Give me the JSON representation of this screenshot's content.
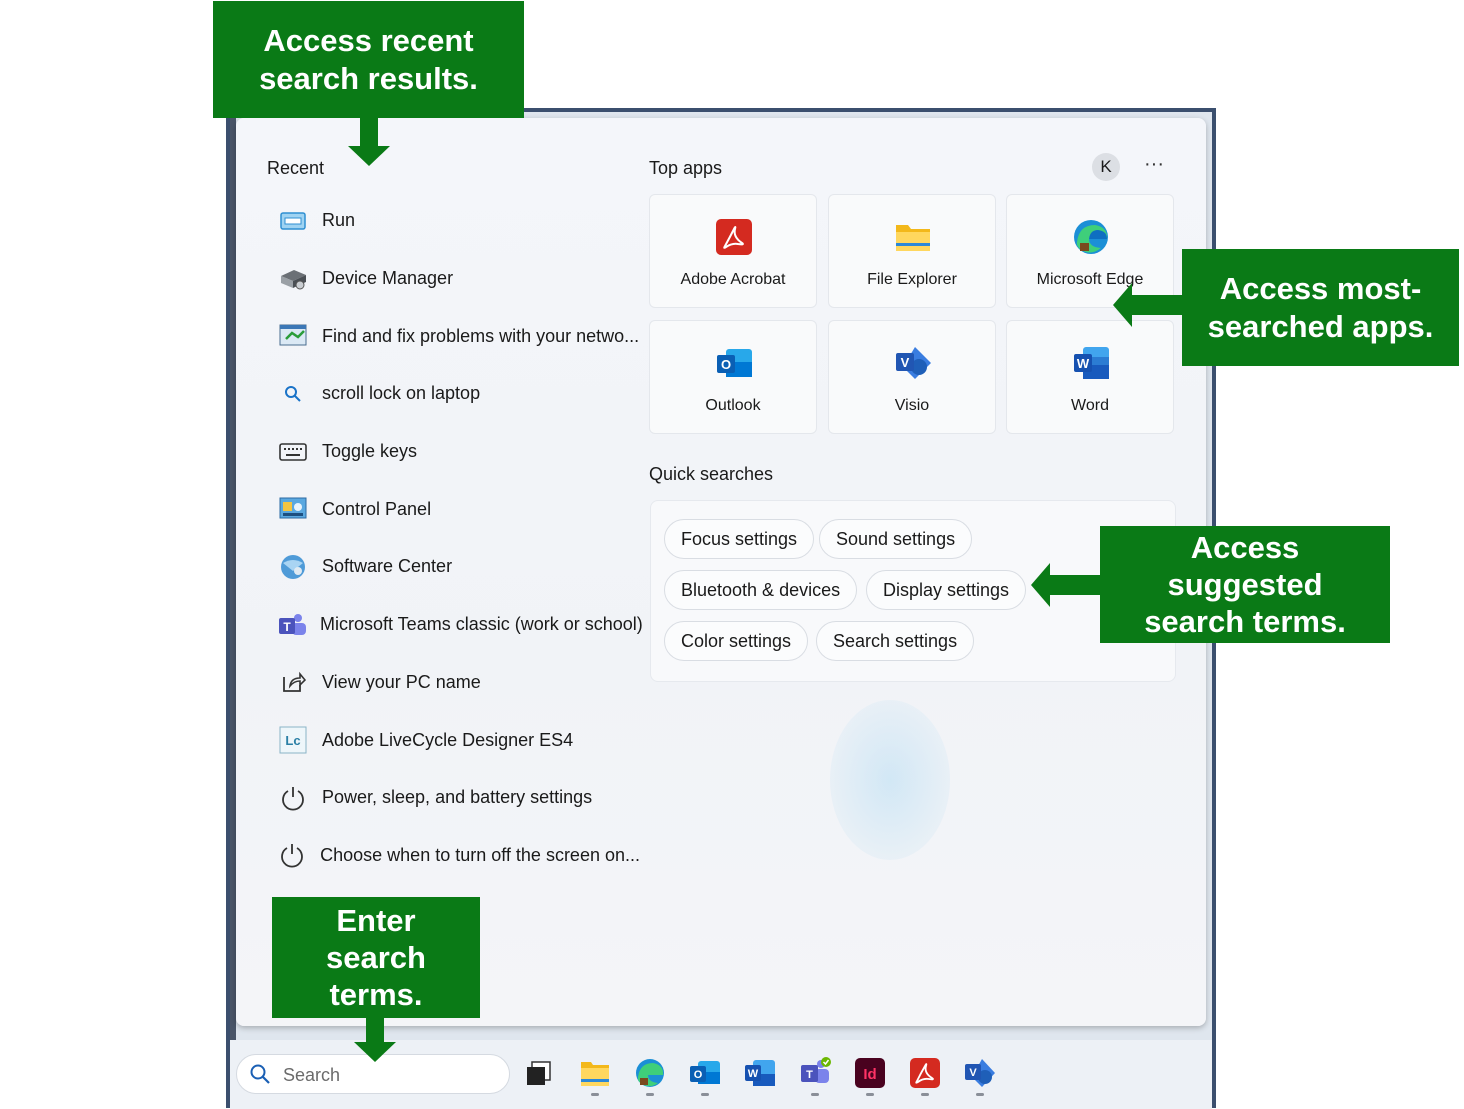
{
  "recent": {
    "heading": "Recent",
    "items": [
      {
        "label": "Run",
        "icon": "run-icon"
      },
      {
        "label": "Device Manager",
        "icon": "device-manager-icon"
      },
      {
        "label": "Find and fix problems with your netwo...",
        "icon": "network-troubleshoot-icon"
      },
      {
        "label": "scroll lock on laptop",
        "icon": "search-icon"
      },
      {
        "label": "Toggle keys",
        "icon": "keyboard-icon"
      },
      {
        "label": "Control Panel",
        "icon": "control-panel-icon"
      },
      {
        "label": "Software Center",
        "icon": "software-center-icon"
      },
      {
        "label": "Microsoft Teams classic (work or school)",
        "icon": "teams-icon"
      },
      {
        "label": "View your PC name",
        "icon": "share-icon"
      },
      {
        "label": "Adobe LiveCycle Designer ES4",
        "icon": "livecycle-icon"
      },
      {
        "label": "Power, sleep, and battery settings",
        "icon": "power-icon"
      },
      {
        "label": "Choose when to turn off the screen on...",
        "icon": "power-icon"
      }
    ]
  },
  "top_apps": {
    "heading": "Top apps",
    "avatar_letter": "K",
    "more_label": "···",
    "apps": [
      {
        "label": "Adobe Acrobat",
        "icon": "acrobat-icon"
      },
      {
        "label": "File Explorer",
        "icon": "folder-icon"
      },
      {
        "label": "Microsoft Edge",
        "icon": "edge-icon"
      },
      {
        "label": "Outlook",
        "icon": "outlook-icon"
      },
      {
        "label": "Visio",
        "icon": "visio-icon"
      },
      {
        "label": "Word",
        "icon": "word-icon"
      }
    ]
  },
  "quick_searches": {
    "heading": "Quick searches",
    "pills": [
      "Focus settings",
      "Sound settings",
      "Bluetooth & devices",
      "Display settings",
      "Color settings",
      "Search settings"
    ]
  },
  "taskbar": {
    "search_placeholder": "Search",
    "icons": [
      "task-view-icon",
      "file-explorer-icon",
      "edge-icon",
      "outlook-icon",
      "word-icon",
      "teams-icon",
      "indesign-icon",
      "acrobat-icon",
      "visio-icon"
    ],
    "indesign_label": "Id",
    "word_letter": "W",
    "outlook_letter": "O",
    "visio_letter": "V",
    "teams_letter": "T",
    "lc_label": "Lc"
  },
  "callouts": {
    "recent": "Access recent\nsearch results.",
    "top_apps": "Access most-\nsearched apps.",
    "quick": "Access\nsuggested\nsearch terms.",
    "search": "Enter\nsearch\nterms."
  },
  "colors": {
    "callout_green": "#0a7a16",
    "frame": "#3b4f6e"
  }
}
